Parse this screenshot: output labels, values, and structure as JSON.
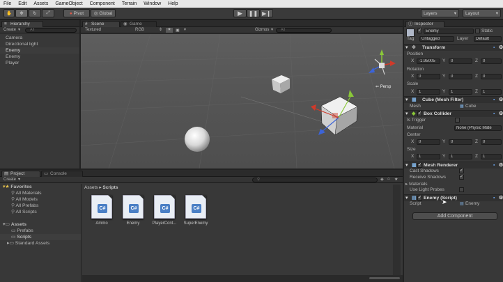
{
  "menu": [
    "File",
    "Edit",
    "Assets",
    "GameObject",
    "Component",
    "Terrain",
    "Window",
    "Help"
  ],
  "toolbar": {
    "pivot": "Pivot",
    "global": "Global",
    "layers": "Layers",
    "layout": "Layout"
  },
  "hierarchy": {
    "tab": "Hierarchy",
    "create": "Create",
    "search": "All",
    "items": [
      "Camera",
      "Directional light",
      "Enemy",
      "Enemy",
      "Player"
    ],
    "selected_index": 2
  },
  "scene": {
    "tab": "Scene",
    "game_tab": "Game",
    "shading": "Textured",
    "render": "RGB",
    "gizmos": "Gizmos",
    "search": "All",
    "persp": "Persp"
  },
  "project": {
    "tab": "Project",
    "console_tab": "Console",
    "create": "Create",
    "breadcrumb": [
      "Assets",
      "Scripts"
    ],
    "favorites_label": "Favorites",
    "favorites": [
      "All Materials",
      "All Models",
      "All Prefabs",
      "All Scripts"
    ],
    "assets_label": "Assets",
    "assets": [
      "Prefabs",
      "Scripts",
      "Standard Assets"
    ],
    "scripts": [
      {
        "name": "Ammo",
        "icon": "C#"
      },
      {
        "name": "Enemy",
        "icon": "C#"
      },
      {
        "name": "PlayerCont...",
        "icon": "C#"
      },
      {
        "name": "SuperEnemy",
        "icon": "C#"
      }
    ]
  },
  "inspector": {
    "tab": "Inspector",
    "object_name": "Enemy",
    "static": "Static",
    "tag_label": "Tag",
    "tag": "Untagged",
    "layer_label": "Layer",
    "layer": "Default",
    "transform": {
      "title": "Transform",
      "position_label": "Position",
      "rotation_label": "Rotation",
      "scale_label": "Scale",
      "position": {
        "x": "-1.95005",
        "y": "0",
        "z": "0"
      },
      "rotation": {
        "x": "0",
        "y": "0",
        "z": "0"
      },
      "scale": {
        "x": "1",
        "y": "1",
        "z": "1"
      }
    },
    "mesh_filter": {
      "title": "Cube (Mesh Filter)",
      "mesh_label": "Mesh",
      "mesh": "Cube"
    },
    "box_collider": {
      "title": "Box Collider",
      "is_trigger": "Is Trigger",
      "material_label": "Material",
      "material": "None (Physic Mate",
      "center_label": "Center",
      "size_label": "Size",
      "center": {
        "x": "0",
        "y": "0",
        "z": "0"
      },
      "size": {
        "x": "1",
        "y": "1",
        "z": "1"
      }
    },
    "mesh_renderer": {
      "title": "Mesh Renderer",
      "cast_shadows": "Cast Shadows",
      "receive_shadows": "Receive Shadows",
      "materials": "Materials",
      "use_light_probes": "Use Light Probes"
    },
    "script": {
      "title": "Enemy (Script)",
      "script_label": "Script",
      "script": "Enemy"
    },
    "add_component": "Add Component"
  },
  "colors": {
    "menubar": "#e8e8e8",
    "panel": "#383838",
    "viewport": "#5a5a5a",
    "accent": "#4a7fc5"
  }
}
